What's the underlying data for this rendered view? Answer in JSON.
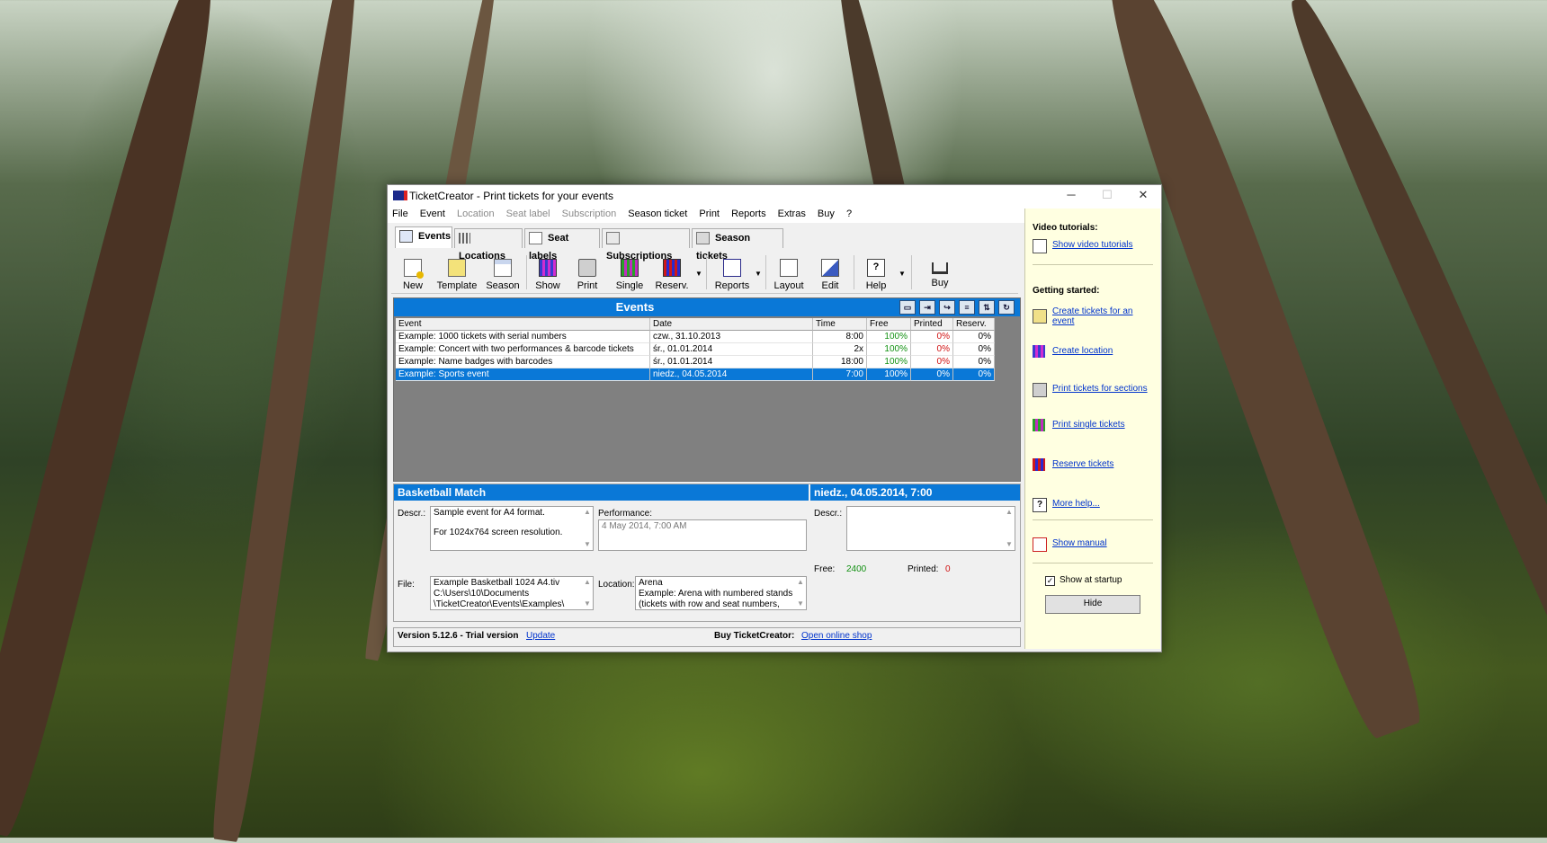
{
  "window": {
    "title": "TicketCreator - Print tickets for your events",
    "minimize": "─",
    "maximize": "☐",
    "close": "✕"
  },
  "menu": [
    {
      "label": "File",
      "enabled": true
    },
    {
      "label": "Event",
      "enabled": true
    },
    {
      "label": "Location",
      "enabled": false
    },
    {
      "label": "Seat label",
      "enabled": false
    },
    {
      "label": "Subscription",
      "enabled": false
    },
    {
      "label": "Season ticket",
      "enabled": true
    },
    {
      "label": "Print",
      "enabled": true
    },
    {
      "label": "Reports",
      "enabled": true
    },
    {
      "label": "Extras",
      "enabled": true
    },
    {
      "label": "Buy",
      "enabled": true
    },
    {
      "label": "?",
      "enabled": true
    }
  ],
  "tabs": [
    "Events",
    "Locations",
    "Seat labels",
    "Subscriptions",
    "Season tickets"
  ],
  "toolbar": [
    "New",
    "Template",
    "Season",
    "Show",
    "Print",
    "Single",
    "Reserv.",
    "Reports",
    "Layout",
    "Edit",
    "Help",
    "Buy"
  ],
  "events": {
    "title": "Events",
    "columns": [
      "Event",
      "Date",
      "Time",
      "Free",
      "Printed",
      "Reserv."
    ],
    "rows": [
      {
        "event": "Example: 1000 tickets with serial numbers",
        "date": "czw., 31.10.2013",
        "time": "8:00",
        "free": "100%",
        "printed": "0%",
        "reserv": "0%"
      },
      {
        "event": "Example: Concert with two performances & barcode tickets",
        "date": "śr., 01.01.2014",
        "time": "2x",
        "free": "100%",
        "printed": "0%",
        "reserv": "0%"
      },
      {
        "event": "Example: Name badges with barcodes",
        "date": "śr., 01.01.2014",
        "time": "18:00",
        "free": "100%",
        "printed": "0%",
        "reserv": "0%"
      },
      {
        "event": "Example: Sports event",
        "date": "niedz., 04.05.2014",
        "time": "7:00",
        "free": "100%",
        "printed": "0%",
        "reserv": "0%"
      }
    ]
  },
  "detail": {
    "event_name": "Basketball Match",
    "performance_date": "niedz., 04.05.2014, 7:00",
    "descr_label": "Descr.:",
    "descr_line1": "Sample event for A4 format.",
    "descr_line2": "For 1024x764 screen resolution.",
    "performance_label": "Performance:",
    "performance_value": "4 May 2014, 7:00 AM",
    "file_label": "File:",
    "file_line1": "Example Basketball 1024 A4.tiv",
    "file_line2": "C:\\Users\\10\\Documents",
    "file_line3": "\\TicketCreator\\Events\\Examples\\",
    "location_label": "Location:",
    "location_line1": "Arena",
    "location_line2": "Example: Arena with numbered stands",
    "location_line3": "(tickets with row and seat numbers,",
    "right_descr_label": "Descr.:",
    "free_label": "Free:",
    "free_value": "2400",
    "printed_label": "Printed:",
    "printed_value": "0"
  },
  "status": {
    "version": "Version 5.12.6 - Trial version",
    "update_link": "Update",
    "buy_label": "Buy TicketCreator:",
    "shop_link": "Open online shop"
  },
  "sidebar": {
    "video_heading": "Video tutorials:",
    "video_link": "Show video tutorials",
    "getting_started_heading": "Getting started:",
    "links": [
      {
        "line1": "Create tickets for an",
        "line2": "event"
      },
      {
        "line1": "Create location",
        "line2": ""
      },
      {
        "line1": "Print tickets for sections",
        "line2": ""
      },
      {
        "line1": "Print single tickets",
        "line2": ""
      },
      {
        "line1": "Reserve tickets",
        "line2": ""
      },
      {
        "line1": "More help...",
        "line2": ""
      },
      {
        "line1": "Show manual",
        "line2": ""
      }
    ],
    "show_at_startup": "Show at startup",
    "show_at_startup_checked": true,
    "hide_button": "Hide"
  },
  "colors": {
    "accent": "#0a78d7",
    "sidebar_bg": "#ffffe1",
    "free_green": "#109010",
    "zero_red": "#d01010",
    "link": "#0033cc"
  }
}
